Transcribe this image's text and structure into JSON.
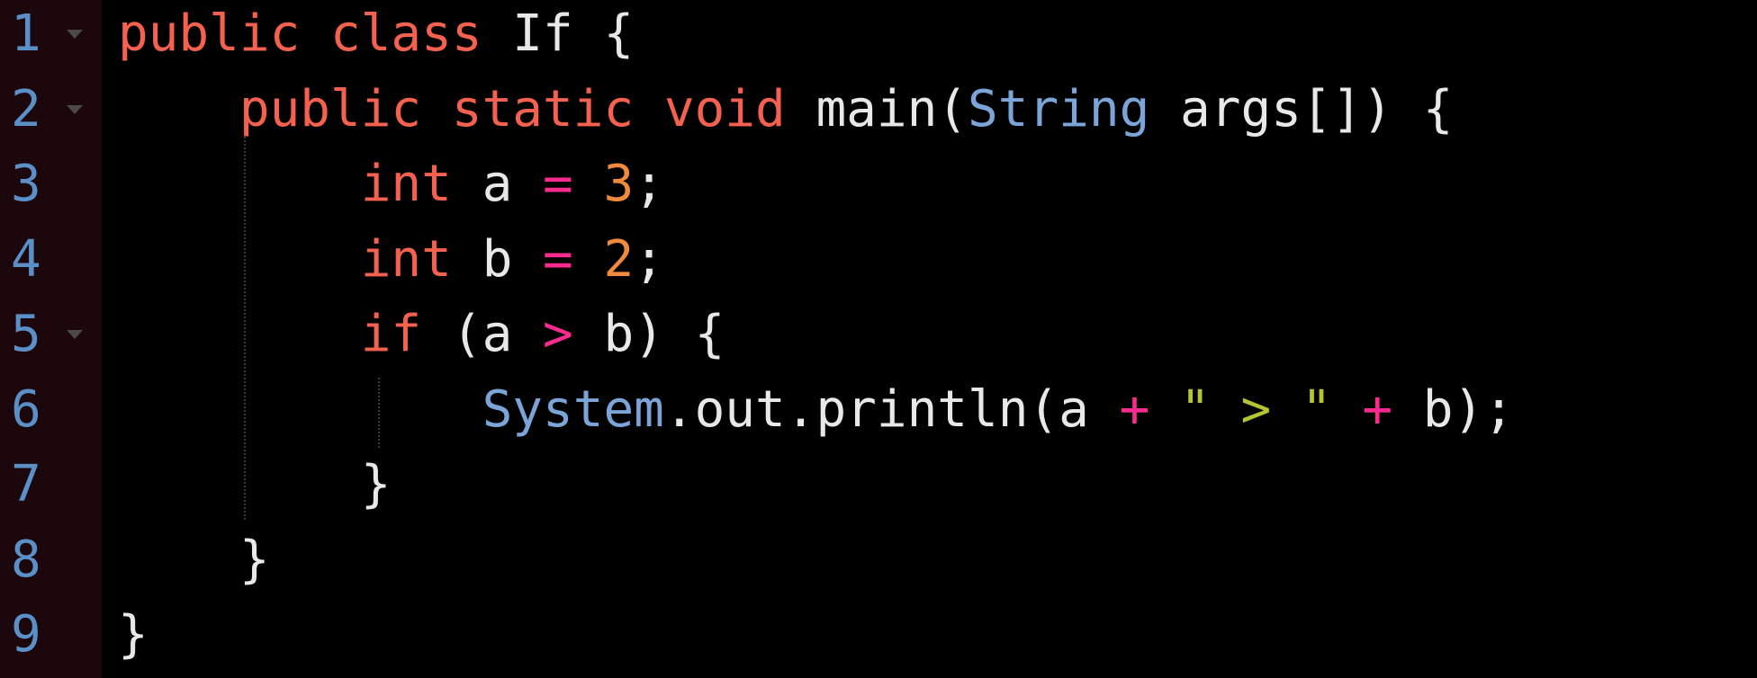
{
  "editor": {
    "colors": {
      "background": "#000000",
      "gutter_background": "#1c070d",
      "line_number": "#5b8fc7",
      "keyword": "#f5614f",
      "type": "#7ba5d9",
      "operator": "#ff2a90",
      "number": "#f08a3c",
      "string": "#b5c42f",
      "identifier": "#e8e8e8"
    },
    "line_numbers": [
      "1",
      "2",
      "3",
      "4",
      "5",
      "6",
      "7",
      "8",
      "9"
    ],
    "folded_lines": [
      "1",
      "2",
      "5"
    ],
    "lines": [
      {
        "tokens": [
          {
            "kind": "kw",
            "text": "public class"
          },
          {
            "kind": "ident",
            "text": " If {"
          }
        ]
      },
      {
        "tokens": [
          {
            "kind": "ident",
            "text": "    "
          },
          {
            "kind": "kw",
            "text": "public static void"
          },
          {
            "kind": "ident",
            "text": " main("
          },
          {
            "kind": "type",
            "text": "String"
          },
          {
            "kind": "ident",
            "text": " args[]) {"
          }
        ]
      },
      {
        "tokens": [
          {
            "kind": "ident",
            "text": "        "
          },
          {
            "kind": "kw",
            "text": "int"
          },
          {
            "kind": "ident",
            "text": " a "
          },
          {
            "kind": "op",
            "text": "="
          },
          {
            "kind": "ident",
            "text": " "
          },
          {
            "kind": "num",
            "text": "3"
          },
          {
            "kind": "ident",
            "text": ";"
          }
        ]
      },
      {
        "tokens": [
          {
            "kind": "ident",
            "text": "        "
          },
          {
            "kind": "kw",
            "text": "int"
          },
          {
            "kind": "ident",
            "text": " b "
          },
          {
            "kind": "op",
            "text": "="
          },
          {
            "kind": "ident",
            "text": " "
          },
          {
            "kind": "num",
            "text": "2"
          },
          {
            "kind": "ident",
            "text": ";"
          }
        ]
      },
      {
        "tokens": [
          {
            "kind": "ident",
            "text": "        "
          },
          {
            "kind": "kw",
            "text": "if"
          },
          {
            "kind": "ident",
            "text": " (a "
          },
          {
            "kind": "op",
            "text": ">"
          },
          {
            "kind": "ident",
            "text": " b) {"
          }
        ]
      },
      {
        "tokens": [
          {
            "kind": "ident",
            "text": "            "
          },
          {
            "kind": "type",
            "text": "System"
          },
          {
            "kind": "ident",
            "text": ".out.println(a "
          },
          {
            "kind": "op",
            "text": "+"
          },
          {
            "kind": "ident",
            "text": " "
          },
          {
            "kind": "str",
            "text": "\" > \""
          },
          {
            "kind": "ident",
            "text": " "
          },
          {
            "kind": "op",
            "text": "+"
          },
          {
            "kind": "ident",
            "text": " b);"
          }
        ]
      },
      {
        "tokens": [
          {
            "kind": "ident",
            "text": "        }"
          }
        ]
      },
      {
        "tokens": [
          {
            "kind": "ident",
            "text": "    }"
          }
        ]
      },
      {
        "tokens": [
          {
            "kind": "ident",
            "text": "}"
          }
        ]
      }
    ]
  }
}
